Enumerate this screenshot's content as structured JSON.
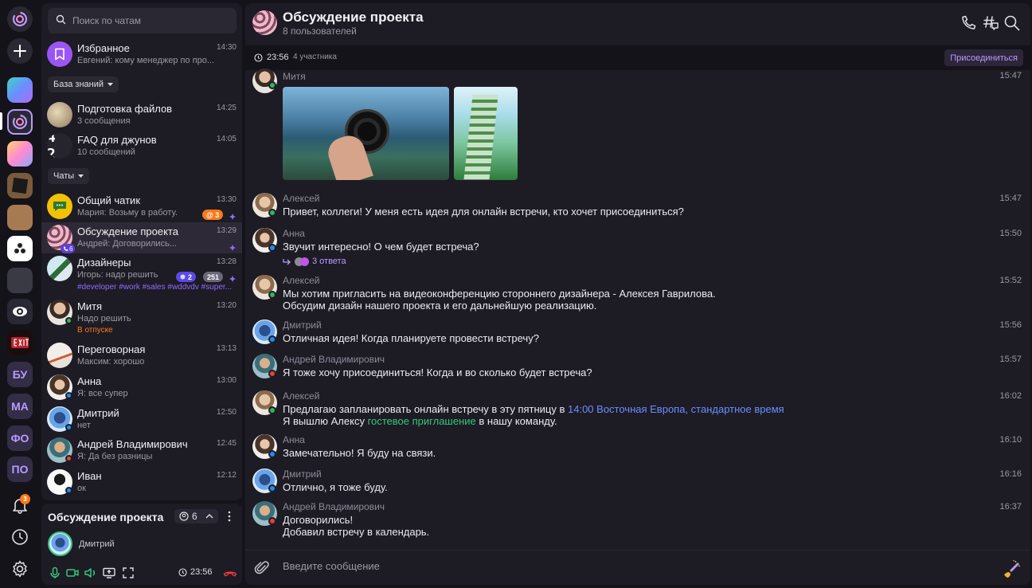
{
  "colors": {
    "accent": "#b79cff",
    "online": "#2fb65c",
    "away": "#1e8bff",
    "busy": "#ef3b3b",
    "bg": "#141319",
    "panel": "#1d1b24"
  },
  "rail": {
    "items": [
      "БУ",
      "МА",
      "ФО",
      "ПО"
    ],
    "notifications_count": "3",
    "icons": [
      "app-logo-icon",
      "plus-icon",
      "workspace-icon",
      "bell-icon",
      "history-icon",
      "settings-icon"
    ]
  },
  "search": {
    "placeholder": "Поиск по чатам"
  },
  "favorites": {
    "title": "Избранное",
    "subtitle": "Евгений: кому менеджер по про...",
    "time": "14:30"
  },
  "sections": {
    "knowledge": "База знаний",
    "chats": "Чаты"
  },
  "knowledge_items": [
    {
      "title": "Подготовка файлов",
      "subtitle": "3 сообщения",
      "time": "14:25"
    },
    {
      "title": "FAQ для джунов",
      "subtitle": "10 сообщений",
      "time": "14:05",
      "avatar_text": "4 2"
    }
  ],
  "chats": [
    {
      "title": "Общий чатик",
      "subtitle": "Мария: Возьму в работу.",
      "time": "13:30",
      "badge": "@ 3"
    },
    {
      "title": "Обсуждение проекта",
      "subtitle": "Андрей: Договорились...",
      "time": "13:29",
      "call_badge": "6"
    },
    {
      "title": "Дизайнеры",
      "subtitle": "Игорь: надо решить",
      "time": "13:28",
      "badge_a": "2",
      "badge_b": "251",
      "tags": "#developer #work #sales #wddvdv #super..."
    },
    {
      "title": "Митя",
      "subtitle": "Надо решить",
      "time": "13:20",
      "status": "В отпуске"
    },
    {
      "title": "Переговорная",
      "subtitle": "Максим: хорошо",
      "time": "13:13"
    },
    {
      "title": "Анна",
      "subtitle": "Я: все супер",
      "time": "13:00"
    },
    {
      "title": "Дмитрий",
      "subtitle": "нет",
      "time": "12:50"
    },
    {
      "title": "Андрей Владимирович",
      "subtitle": "Я: Да без разницы",
      "time": "12:45"
    },
    {
      "title": "Иван",
      "subtitle": "ок",
      "time": "12:12"
    }
  ],
  "call_panel": {
    "title": "Обсуждение проекта",
    "count": "6",
    "user": "Дмитрий",
    "timer": "23:56"
  },
  "header": {
    "title": "Обсуждение проекта",
    "subtitle": "8 пользователей"
  },
  "callbar": {
    "time": "23:56",
    "participants": "4 участника",
    "join": "Присоединиться"
  },
  "messages": [
    {
      "name": "Митя",
      "time": "15:47"
    },
    {
      "name": "Алексей",
      "time": "15:47",
      "lines": [
        "Привет, коллеги! У меня есть идея для онлайн встречи, кто хочет присоединиться?"
      ]
    },
    {
      "name": "Анна",
      "time": "15:50",
      "lines": [
        "Звучит интересно! О чем будет встреча?"
      ],
      "thread": "3 ответа"
    },
    {
      "name": "Алексей",
      "time": "15:52",
      "lines": [
        "Мы хотим пригласить на видеоконференцию стороннего дизайнера - Алексея Гаврилова.",
        "Обсудим дизайн нашего проекта и его дальнейшую реализацию."
      ]
    },
    {
      "name": "Дмитрий",
      "time": "15:56",
      "lines": [
        "Отличная идея! Когда планируете провести встречу?"
      ]
    },
    {
      "name": "Андрей Владимирович",
      "time": "15:57",
      "lines": [
        "Я тоже хочу присоединиться! Когда и во сколько будет встреча?"
      ]
    },
    {
      "name": "Алексей",
      "time": "16:02",
      "line1_a": "Предлагаю запланировать онлайн встречу в эту пятницу в ",
      "line1_link": "14:00 Восточная Европа, стандартное время",
      "line2_a": "Я вышлю Алексу ",
      "line2_link": "гостевое приглашение",
      "line2_b": " в нашу команду."
    },
    {
      "name": "Анна",
      "time": "16:10",
      "lines": [
        "Замечательно! Я буду на связи."
      ]
    },
    {
      "name": "Дмитрий",
      "time": "16:16",
      "lines": [
        "Отлично, я тоже буду."
      ]
    },
    {
      "name": "Андрей Владимирович",
      "time": "16:37",
      "lines": [
        "Договорились!",
        "Добавил встречу в календарь."
      ]
    }
  ],
  "composer": {
    "placeholder": "Введите сообщение"
  }
}
